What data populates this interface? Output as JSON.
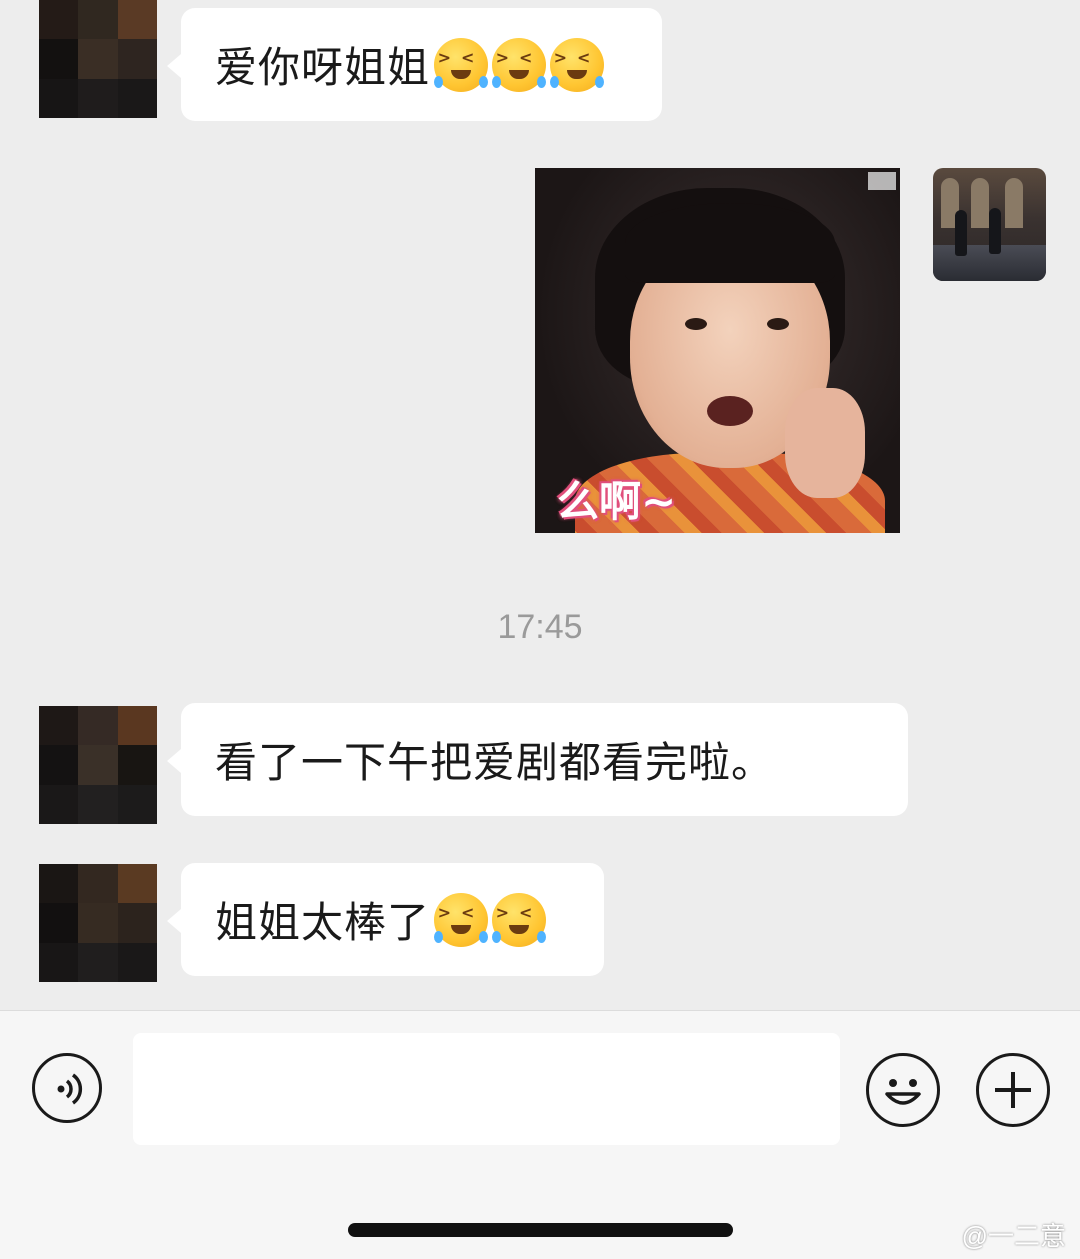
{
  "messages": [
    {
      "side": "left",
      "text": "爱你呀姐姐",
      "emoji_count": 3,
      "emoji": "tearful-laughing-emoji"
    },
    {
      "side": "right",
      "type": "sticker",
      "caption": "么啊~"
    },
    {
      "side": "left",
      "text": "看了一下午把爱剧都看完啦。"
    },
    {
      "side": "left",
      "text": "姐姐太棒了",
      "emoji_count": 2,
      "emoji": "tearful-laughing-emoji"
    }
  ],
  "timestamp": "17:45",
  "input_bar": {
    "voice_icon": "voice-icon",
    "emoji_icon": "emoji-icon",
    "plus_icon": "plus-icon",
    "text_value": ""
  },
  "watermark": "@一二意",
  "colors": {
    "background": "#ededed",
    "bubble": "#ffffff"
  }
}
